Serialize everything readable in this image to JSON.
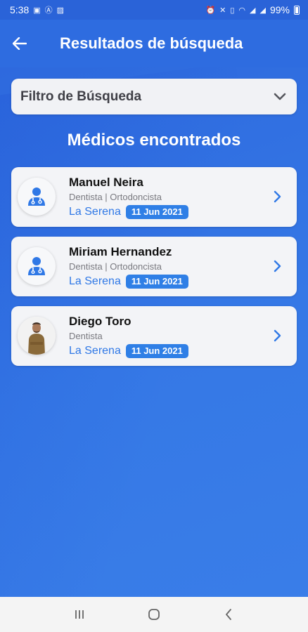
{
  "status_bar": {
    "time": "5:38",
    "battery": "99%"
  },
  "app_bar": {
    "title": "Resultados de búsqueda"
  },
  "filter": {
    "label": "Filtro de Búsqueda"
  },
  "section_title": "Médicos encontrados",
  "doctors": [
    {
      "name": "Manuel Neira",
      "specialty": "Dentista | Ortodoncista",
      "city": "La Serena",
      "date": "11 Jun 2021",
      "avatar": "doctor-icon"
    },
    {
      "name": "Miriam Hernandez",
      "specialty": "Dentista | Ortodoncista",
      "city": "La Serena",
      "date": "11 Jun 2021",
      "avatar": "doctor-icon"
    },
    {
      "name": "Diego Toro",
      "specialty": "Dentista",
      "city": "La Serena",
      "date": "11 Jun 2021",
      "avatar": "photo"
    }
  ],
  "colors": {
    "primary": "#2e6ce0",
    "accent": "#2f7fe6",
    "card": "#f3f4f7"
  }
}
